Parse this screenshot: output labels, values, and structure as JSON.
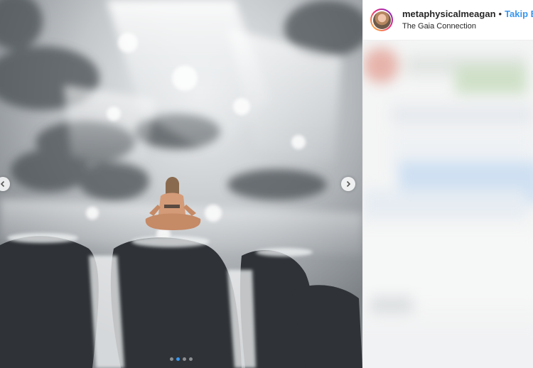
{
  "post": {
    "username": "metaphysicalmeagan",
    "separator": "•",
    "follow_label": "Takip Et",
    "location": "The Gaia Connection"
  },
  "carousel": {
    "slide_count": 4,
    "active_index": 1,
    "prev_icon": "chevron-left-icon",
    "next_icon": "chevron-right-icon",
    "accent_color": "#3897f0"
  },
  "comments": {
    "state": "blurred"
  }
}
